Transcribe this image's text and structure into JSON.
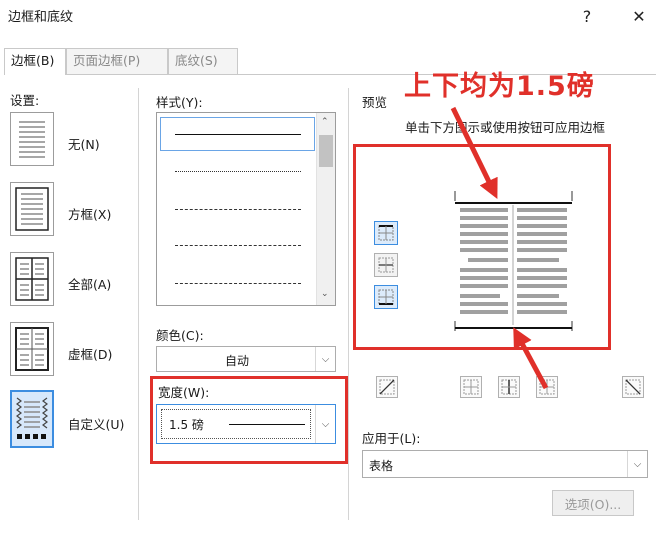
{
  "window": {
    "title": "边框和底纹",
    "help_label": "?",
    "close_label": "✕"
  },
  "tabs": [
    {
      "label": "边框(B)",
      "active": true
    },
    {
      "label": "页面边框(P)",
      "active": false
    },
    {
      "label": "底纹(S)",
      "active": false
    }
  ],
  "settings": {
    "label": "设置:",
    "items": [
      {
        "label": "无(N)",
        "icon": "setting-none-icon"
      },
      {
        "label": "方框(X)",
        "icon": "setting-box-icon"
      },
      {
        "label": "全部(A)",
        "icon": "setting-all-icon"
      },
      {
        "label": "虚框(D)",
        "icon": "setting-grid-icon"
      },
      {
        "label": "自定义(U)",
        "icon": "setting-custom-icon",
        "selected": true
      }
    ]
  },
  "style": {
    "label": "样式(Y):",
    "options": [
      "solid",
      "dotted",
      "dashed-small",
      "dashed",
      "dash-dot"
    ]
  },
  "color": {
    "label": "颜色(C):",
    "value": "自动"
  },
  "width": {
    "label": "宽度(W):",
    "value": "1.5 磅"
  },
  "preview": {
    "label": "预览",
    "hint": "单击下方图示或使用按钮可应用边框"
  },
  "apply_to": {
    "label": "应用于(L):",
    "value": "表格"
  },
  "options_button": "选项(O)...",
  "annotation": {
    "text": "上下均为1.5磅",
    "color": "#e0302a"
  }
}
